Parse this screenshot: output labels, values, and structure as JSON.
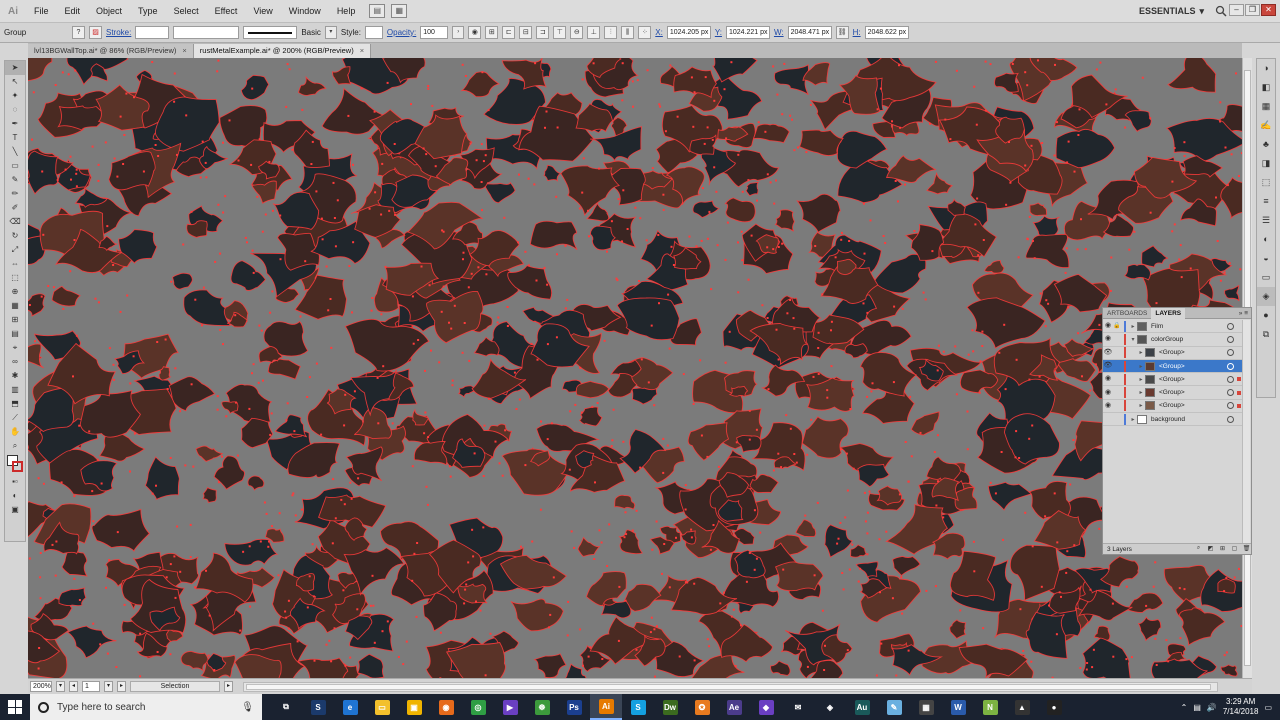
{
  "app": {
    "logo": "Ai",
    "menu": [
      "File",
      "Edit",
      "Object",
      "Type",
      "Select",
      "Effect",
      "View",
      "Window",
      "Help"
    ],
    "workspace": "ESSENTIALS"
  },
  "control_bar": {
    "selection_type": "Group",
    "stroke_label": "Stroke:",
    "stroke_style": "Basic",
    "style_label": "Style:",
    "opacity_label": "Opacity:",
    "opacity_value": "100",
    "x_label": "X:",
    "x_value": "1024.205 px",
    "y_label": "Y:",
    "y_value": "1024.221 px",
    "w_label": "W:",
    "w_value": "2048.471 px",
    "h_label": "H:",
    "h_value": "2048.622 px"
  },
  "tabs": [
    {
      "label": "lvl13BGWallTop.ai* @ 86% (RGB/Preview)",
      "close": "×",
      "active": false
    },
    {
      "label": "rustMetalExample.ai* @ 200% (RGB/Preview)",
      "close": "×",
      "active": true
    }
  ],
  "status_bar": {
    "zoom": "200%",
    "artboard": "1",
    "status": "Selection"
  },
  "layers_panel": {
    "tabs": [
      "ARTBOARDS",
      "LAYERS"
    ],
    "active_tab": "LAYERS",
    "layers": [
      {
        "name": "Film",
        "color": "#4e7ad8",
        "thumb": "#606060",
        "indent": 0,
        "selected": false
      },
      {
        "name": "colorGroup",
        "color": "#d8453b",
        "thumb": "#555555",
        "indent": 0,
        "selected": false
      },
      {
        "name": "<Group>",
        "color": "#d8453b",
        "thumb": "#3c4148",
        "indent": 1,
        "selected": false
      },
      {
        "name": "<Group>",
        "color": "#d8453b",
        "thumb": "#5a3b32",
        "indent": 1,
        "selected": true
      },
      {
        "name": "<Group>",
        "color": "#d8453b",
        "thumb": "#4a4a4a",
        "indent": 1,
        "selected": false
      },
      {
        "name": "<Group>",
        "color": "#d8453b",
        "thumb": "#6a3a30",
        "indent": 1,
        "selected": false
      },
      {
        "name": "<Group>",
        "color": "#d8453b",
        "thumb": "#7a5a48",
        "indent": 1,
        "selected": false
      },
      {
        "name": "background",
        "color": "#4e7ad8",
        "thumb": "#ffffff",
        "indent": 0,
        "selected": false
      }
    ],
    "footer": "3 Layers"
  },
  "taskbar": {
    "search_placeholder": "Type here to search",
    "apps": [
      {
        "name": "task-view",
        "label": "⧉",
        "bg": "transparent"
      },
      {
        "name": "steam",
        "label": "S",
        "bg": "#1b3a6b"
      },
      {
        "name": "edge",
        "label": "e",
        "bg": "#1f74d2"
      },
      {
        "name": "file-explorer",
        "label": "▭",
        "bg": "#f3c02c"
      },
      {
        "name": "store",
        "label": "▣",
        "bg": "#f0b400"
      },
      {
        "name": "firefox",
        "label": "◉",
        "bg": "#e66a1b"
      },
      {
        "name": "chrome",
        "label": "◎",
        "bg": "#2f9e44"
      },
      {
        "name": "visual-studio",
        "label": "▶",
        "bg": "#6a3fc2"
      },
      {
        "name": "git",
        "label": "☸",
        "bg": "#3c9a3c"
      },
      {
        "name": "photoshop",
        "label": "Ps",
        "bg": "#1b3f8f"
      },
      {
        "name": "illustrator",
        "label": "Ai",
        "bg": "#e67a00"
      },
      {
        "name": "skype",
        "label": "S",
        "bg": "#14a0e0"
      },
      {
        "name": "dreamweaver",
        "label": "Dw",
        "bg": "#3b6b1f"
      },
      {
        "name": "blender",
        "label": "✪",
        "bg": "#e87a1f"
      },
      {
        "name": "after-effects",
        "label": "Ae",
        "bg": "#4b3c8b"
      },
      {
        "name": "vs-code",
        "label": "◆",
        "bg": "#6a3fc2"
      },
      {
        "name": "mail",
        "label": "✉",
        "bg": "transparent"
      },
      {
        "name": "unity",
        "label": "◈",
        "bg": "transparent"
      },
      {
        "name": "audition",
        "label": "Au",
        "bg": "#1a5a5a"
      },
      {
        "name": "notepad",
        "label": "✎",
        "bg": "#6ab0e0"
      },
      {
        "name": "calculator",
        "label": "▦",
        "bg": "#444"
      },
      {
        "name": "word",
        "label": "W",
        "bg": "#2a5bab"
      },
      {
        "name": "notepad-plus",
        "label": "N",
        "bg": "#7cb342"
      },
      {
        "name": "photos",
        "label": "▲",
        "bg": "#333"
      },
      {
        "name": "obs",
        "label": "●",
        "bg": "#222"
      }
    ],
    "time": "3:29 AM",
    "date": "7/14/2018"
  },
  "colors": {
    "canvas_gray": "#7b7b7b",
    "rust": "#4a2a22",
    "dark_steel": "#20262c",
    "path_highlight": "#ff3b3b",
    "selection_blue": "#3b78c9"
  }
}
